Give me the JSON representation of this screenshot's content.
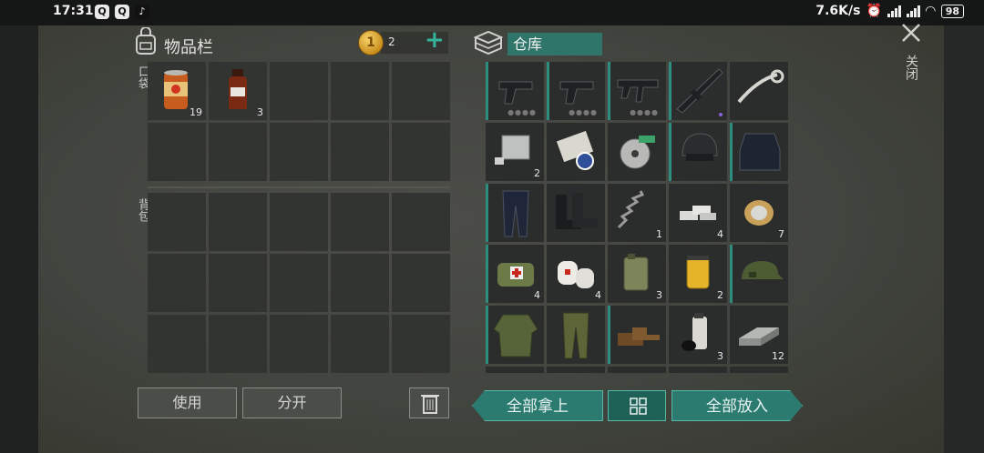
{
  "status_bar": {
    "time": "17:31",
    "speed": "7.6K/s",
    "battery": "98"
  },
  "inventory": {
    "title": "物品栏",
    "coins": "2",
    "plus": "+",
    "pocket_label": "口袋",
    "backpack_label": "背包",
    "pocket_items": [
      {
        "name": "canned-food",
        "qty": "19"
      },
      {
        "name": "medicine-bottle",
        "qty": "3"
      }
    ]
  },
  "warehouse": {
    "title": "仓库",
    "rows": [
      [
        {
          "name": "pistol",
          "qty": ""
        },
        {
          "name": "pistol",
          "qty": ""
        },
        {
          "name": "smg",
          "qty": ""
        },
        {
          "name": "assault-rifle",
          "qty": ""
        },
        {
          "name": "handlebar",
          "qty": ""
        }
      ],
      [
        {
          "name": "engine-part",
          "qty": "2"
        },
        {
          "name": "stickers",
          "qty": ""
        },
        {
          "name": "saw-blade",
          "qty": ""
        },
        {
          "name": "helmet",
          "qty": ""
        },
        {
          "name": "armor-vest",
          "qty": ""
        }
      ],
      [
        {
          "name": "tactical-pants",
          "qty": ""
        },
        {
          "name": "boots",
          "qty": ""
        },
        {
          "name": "spring",
          "qty": "1"
        },
        {
          "name": "metal-bars",
          "qty": "4"
        },
        {
          "name": "wire-spool",
          "qty": "7"
        }
      ],
      [
        {
          "name": "medic-bag",
          "qty": "4"
        },
        {
          "name": "bandages",
          "qty": "4"
        },
        {
          "name": "jerrycan",
          "qty": "3"
        },
        {
          "name": "filter",
          "qty": "2"
        },
        {
          "name": "camo-cap",
          "qty": ""
        }
      ],
      [
        {
          "name": "camo-jacket",
          "qty": ""
        },
        {
          "name": "camo-pants",
          "qty": ""
        },
        {
          "name": "shoes",
          "qty": ""
        },
        {
          "name": "spray-can",
          "qty": "3"
        },
        {
          "name": "metal-ingot",
          "qty": "12"
        }
      ]
    ]
  },
  "buttons": {
    "use": "使用",
    "split": "分开",
    "take_all": "全部拿上",
    "put_all": "全部放入",
    "close": "关闭"
  },
  "colors": {
    "accent": "#2c7b70",
    "accent_light": "#36b39b",
    "background": "#42443f"
  }
}
